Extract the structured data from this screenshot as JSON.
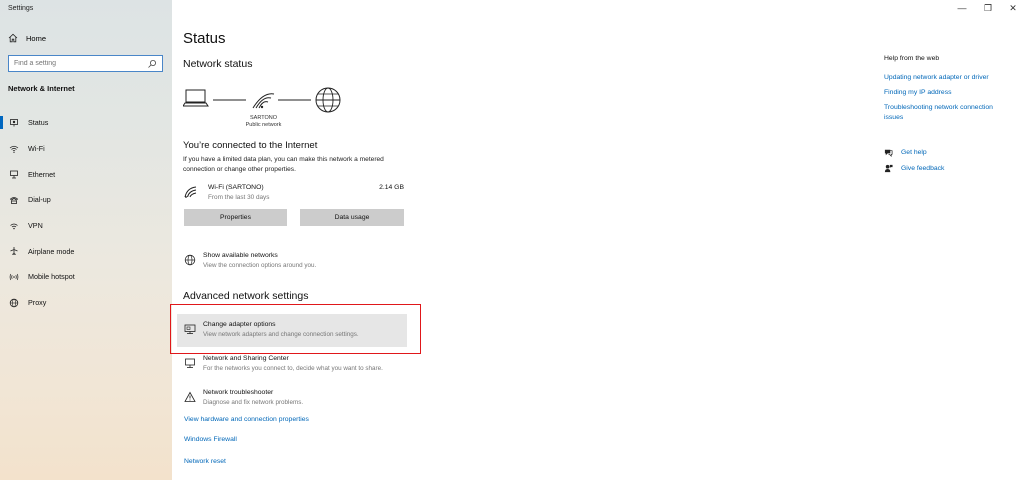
{
  "window": {
    "title": "Settings",
    "controls": [
      "—",
      "❐",
      "✕"
    ]
  },
  "sidebar": {
    "home_label": "Home",
    "search_placeholder": "Find a setting",
    "section_label": "Network & Internet",
    "items": [
      {
        "label": "Status",
        "icon": "status-icon",
        "active": true
      },
      {
        "label": "Wi-Fi",
        "icon": "wifi-icon"
      },
      {
        "label": "Ethernet",
        "icon": "ethernet-icon"
      },
      {
        "label": "Dial-up",
        "icon": "dialup-icon"
      },
      {
        "label": "VPN",
        "icon": "vpn-icon"
      },
      {
        "label": "Airplane mode",
        "icon": "airplane-icon"
      },
      {
        "label": "Mobile hotspot",
        "icon": "hotspot-icon"
      },
      {
        "label": "Proxy",
        "icon": "globe-icon"
      }
    ]
  },
  "main": {
    "title": "Status",
    "network_status_heading": "Network status",
    "network_name": "SARTONO",
    "network_type": "Public network",
    "connected_heading": "You’re connected to the Internet",
    "connected_desc": "If you have a limited data plan, you can make this network a metered connection or change other properties.",
    "connection": {
      "name": "Wi-Fi (SARTONO)",
      "sub": "From the last 30 days",
      "usage": "2.14 GB"
    },
    "buttons": {
      "properties": "Properties",
      "data_usage": "Data usage"
    },
    "show_networks": {
      "title": "Show available networks",
      "desc": "View the connection options around you."
    },
    "advanced_heading": "Advanced network settings",
    "advanced": [
      {
        "title": "Change adapter options",
        "desc": "View network adapters and change connection settings."
      },
      {
        "title": "Network and Sharing Center",
        "desc": "For the networks you connect to, decide what you want to share."
      },
      {
        "title": "Network troubleshooter",
        "desc": "Diagnose and fix network problems."
      }
    ],
    "links": {
      "hardware": "View hardware and connection properties",
      "firewall": "Windows Firewall",
      "reset": "Network reset"
    }
  },
  "right": {
    "help_heading": "Help from the web",
    "links": [
      "Updating network adapter or driver",
      "Finding my IP address",
      "Troubleshooting network connection issues"
    ],
    "get_help": "Get help",
    "give_feedback": "Give feedback"
  },
  "colors": {
    "accent": "#0067c0",
    "link": "#0067b8",
    "highlight_border": "#e0171a"
  }
}
